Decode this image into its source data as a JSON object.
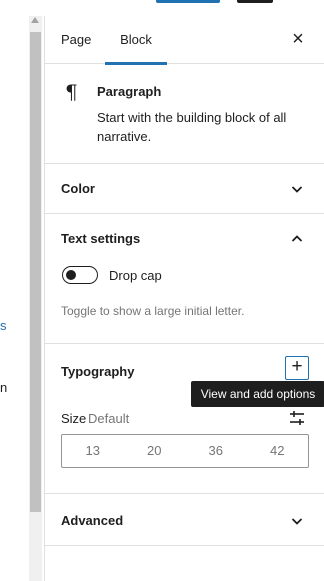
{
  "tabs": {
    "page": "Page",
    "block": "Block"
  },
  "block_card": {
    "title": "Paragraph",
    "description": "Start with the building block of all narrative."
  },
  "panels": {
    "color": "Color",
    "text_settings": "Text settings",
    "typography": "Typography",
    "advanced": "Advanced"
  },
  "drop_cap": {
    "label": "Drop cap",
    "help": "Toggle to show a large initial letter.",
    "enabled": false
  },
  "typography": {
    "tooltip": "View and add options",
    "size_label": "Size",
    "size_value": "Default",
    "sizes": [
      "13",
      "20",
      "36",
      "42"
    ]
  },
  "edge_fragments": {
    "blue": "s",
    "dark": "n"
  },
  "icons": {
    "close": "close-icon",
    "paragraph": "pilcrow-icon",
    "expand": "chevron-down-icon",
    "collapse": "chevron-up-icon",
    "add": "plus-icon",
    "custom_size": "sliders-icon"
  },
  "colors": {
    "accent": "#2271b1",
    "text": "#1e1e1e",
    "muted": "#757575",
    "border": "#e0e0e0"
  }
}
